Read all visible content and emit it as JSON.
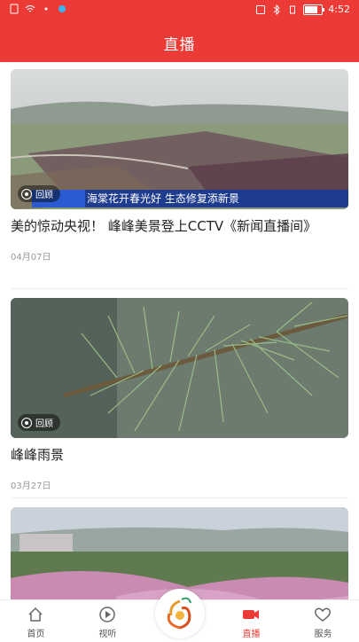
{
  "status_bar": {
    "time": "4:52"
  },
  "header": {
    "title": "直播"
  },
  "cards": [
    {
      "title": "美的惊动央视！ 峰峰美景登上CCTV《新闻直播间》",
      "date": "04月07日",
      "badge": "回顾",
      "caption": "海棠花开春光好  生态修复添新景"
    },
    {
      "title": "峰峰雨景",
      "date": "03月27日",
      "badge": "回顾"
    },
    {
      "title": "",
      "date": "",
      "badge": ""
    }
  ],
  "tabbar": {
    "items": [
      {
        "label": "首页",
        "icon": "home-icon"
      },
      {
        "label": "视听",
        "icon": "play-icon"
      },
      {
        "label": "",
        "icon": "app-logo-icon"
      },
      {
        "label": "直播",
        "icon": "camera-icon",
        "active": true
      },
      {
        "label": "服务",
        "icon": "heart-icon"
      }
    ]
  },
  "colors": {
    "accent": "#ec3b36",
    "date_text": "#999999"
  }
}
